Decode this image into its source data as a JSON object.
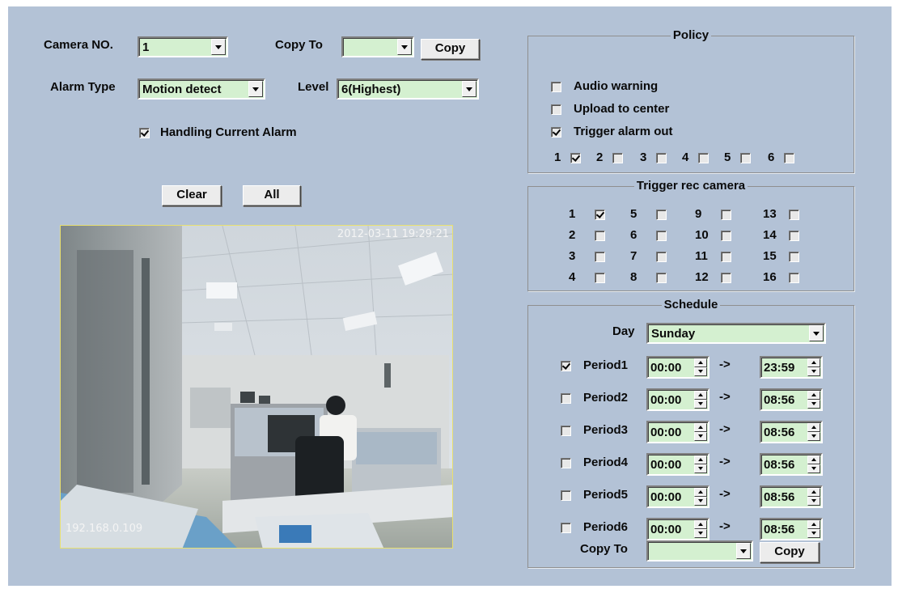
{
  "camera": {
    "label": "Camera NO.",
    "value": "1"
  },
  "copy_to_top": {
    "label": "Copy To",
    "value": "",
    "button": "Copy"
  },
  "alarm_type": {
    "label": "Alarm Type",
    "value": "Motion detect"
  },
  "level": {
    "label": "Level",
    "value": "6(Highest)"
  },
  "handling_current_alarm": {
    "label": "Handling Current Alarm",
    "checked": true
  },
  "buttons": {
    "clear": "Clear",
    "all": "All"
  },
  "preview": {
    "timestamp": "2012-03-11 19:29:21",
    "ip": "192.168.0.109"
  },
  "policy": {
    "title": "Policy",
    "options": [
      {
        "label": "Audio warning",
        "checked": false
      },
      {
        "label": "Upload to center",
        "checked": false
      },
      {
        "label": "Trigger alarm out",
        "checked": true
      }
    ],
    "alarm_outputs": [
      {
        "label": "1",
        "checked": true
      },
      {
        "label": "2",
        "checked": false
      },
      {
        "label": "3",
        "checked": false
      },
      {
        "label": "4",
        "checked": false
      },
      {
        "label": "5",
        "checked": false
      },
      {
        "label": "6",
        "checked": false
      }
    ]
  },
  "trigger_rec": {
    "title": "Trigger rec camera",
    "cameras": [
      {
        "label": "1",
        "checked": true
      },
      {
        "label": "2",
        "checked": false
      },
      {
        "label": "3",
        "checked": false
      },
      {
        "label": "4",
        "checked": false
      },
      {
        "label": "5",
        "checked": false
      },
      {
        "label": "6",
        "checked": false
      },
      {
        "label": "7",
        "checked": false
      },
      {
        "label": "8",
        "checked": false
      },
      {
        "label": "9",
        "checked": false
      },
      {
        "label": "10",
        "checked": false
      },
      {
        "label": "11",
        "checked": false
      },
      {
        "label": "12",
        "checked": false
      },
      {
        "label": "13",
        "checked": false
      },
      {
        "label": "14",
        "checked": false
      },
      {
        "label": "15",
        "checked": false
      },
      {
        "label": "16",
        "checked": false
      }
    ]
  },
  "schedule": {
    "title": "Schedule",
    "day_label": "Day",
    "day_value": "Sunday",
    "arrow": "->",
    "periods": [
      {
        "label": "Period1",
        "checked": true,
        "start": "00:00",
        "end": "23:59"
      },
      {
        "label": "Period2",
        "checked": false,
        "start": "00:00",
        "end": "08:56"
      },
      {
        "label": "Period3",
        "checked": false,
        "start": "00:00",
        "end": "08:56"
      },
      {
        "label": "Period4",
        "checked": false,
        "start": "00:00",
        "end": "08:56"
      },
      {
        "label": "Period5",
        "checked": false,
        "start": "00:00",
        "end": "08:56"
      },
      {
        "label": "Period6",
        "checked": false,
        "start": "00:00",
        "end": "08:56"
      }
    ],
    "copy_to_label": "Copy To",
    "copy_to_value": "",
    "copy_button": "Copy"
  }
}
